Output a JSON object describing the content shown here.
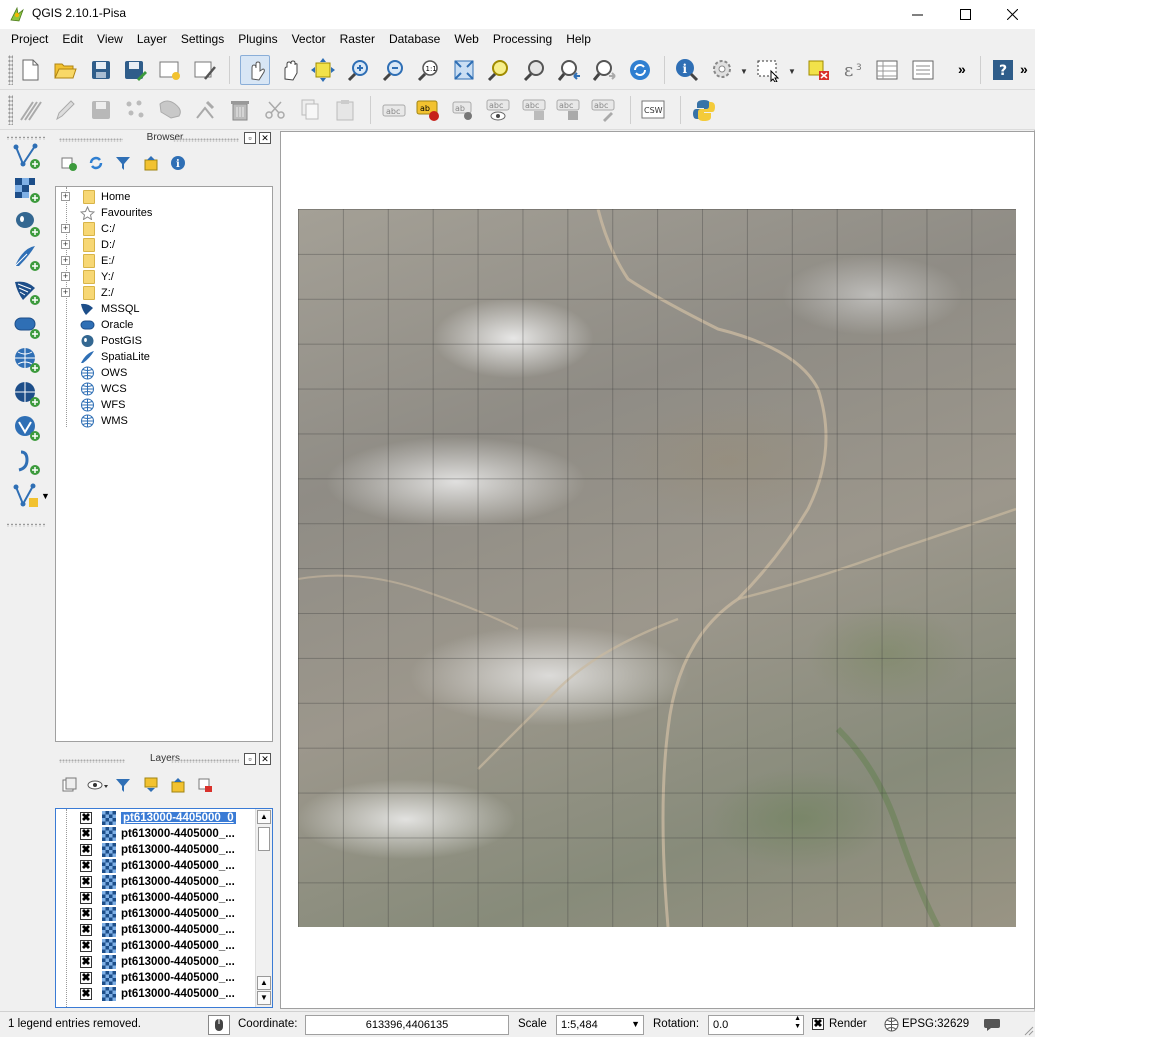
{
  "window": {
    "title": "QGIS 2.10.1-Pisa"
  },
  "menu": [
    "Project",
    "Edit",
    "View",
    "Layer",
    "Settings",
    "Plugins",
    "Vector",
    "Raster",
    "Database",
    "Web",
    "Processing",
    "Help"
  ],
  "toolbar1": {
    "icons": [
      "new-project-icon",
      "open-project-icon",
      "save-project-icon",
      "save-as-icon",
      "new-print-composer-icon",
      "composer-manager-icon",
      "touch-zoom-icon",
      "pan-icon",
      "pan-to-selection-icon",
      "zoom-in-icon",
      "zoom-out-icon",
      "zoom-actual-size-icon",
      "zoom-full-icon",
      "zoom-to-selection-icon",
      "zoom-to-layer-icon",
      "zoom-last-icon",
      "zoom-next-icon",
      "refresh-icon",
      "identify-icon",
      "run-feature-action-icon",
      "select-features-icon",
      "deselect-icon",
      "field-calculator-icon",
      "attribute-table-icon",
      "statistics-icon",
      "help-icon"
    ],
    "overflow": "»"
  },
  "toolbar2": {
    "icons": [
      "current-edits-icon",
      "toggle-editing-icon",
      "save-edits-icon",
      "add-feature-icon",
      "move-feature-icon",
      "node-tool-icon",
      "delete-selected-icon",
      "cut-features-icon",
      "copy-features-icon",
      "paste-features-icon",
      "label-abc-icon",
      "label-layer-icon",
      "pin-labels-icon",
      "show-hide-labels-icon",
      "move-label-icon",
      "rotate-label-icon",
      "change-label-icon",
      "csw-icon",
      "python-console-icon"
    ],
    "csw_label": "CSW",
    "abc_label": "abc",
    "ab_label": "ab"
  },
  "left_toolbar": [
    "add-vector-layer-icon",
    "add-raster-layer-icon",
    "add-postgis-layer-icon",
    "add-spatialite-layer-icon",
    "add-mssql-layer-icon",
    "add-oracle-layer-icon",
    "add-wms-layer-icon",
    "add-wcs-layer-icon",
    "add-wfs-layer-icon",
    "add-delimited-text-icon",
    "new-shapefile-layer-icon"
  ],
  "browser": {
    "title": "Browser",
    "tools": [
      "add-selected-icon",
      "refresh-icon",
      "filter-icon",
      "collapse-all-icon",
      "properties-icon"
    ],
    "items": [
      {
        "label": "Home",
        "icon": "folder",
        "expandable": true
      },
      {
        "label": "Favourites",
        "icon": "star",
        "expandable": false
      },
      {
        "label": "C:/",
        "icon": "folder",
        "expandable": true
      },
      {
        "label": "D:/",
        "icon": "folder",
        "expandable": true
      },
      {
        "label": "E:/",
        "icon": "folder",
        "expandable": true
      },
      {
        "label": "Y:/",
        "icon": "folder",
        "expandable": true
      },
      {
        "label": "Z:/",
        "icon": "folder",
        "expandable": true
      },
      {
        "label": "MSSQL",
        "icon": "mssql",
        "expandable": false
      },
      {
        "label": "Oracle",
        "icon": "oracle",
        "expandable": false
      },
      {
        "label": "PostGIS",
        "icon": "postgis",
        "expandable": false
      },
      {
        "label": "SpatiaLite",
        "icon": "spatialite",
        "expandable": false
      },
      {
        "label": "OWS",
        "icon": "globe",
        "expandable": false
      },
      {
        "label": "WCS",
        "icon": "globe",
        "expandable": false
      },
      {
        "label": "WFS",
        "icon": "globe",
        "expandable": false
      },
      {
        "label": "WMS",
        "icon": "globe",
        "expandable": false
      }
    ]
  },
  "layers": {
    "title": "Layers",
    "tools": [
      "add-group-icon",
      "manage-visibility-icon",
      "filter-legend-icon",
      "expand-all-icon",
      "collapse-all-icon",
      "remove-layer-icon"
    ],
    "items": [
      {
        "name": "pt613000-4405000_0",
        "checked": true,
        "selected": true
      },
      {
        "name": "pt613000-4405000_...",
        "checked": true,
        "selected": false
      },
      {
        "name": "pt613000-4405000_...",
        "checked": true,
        "selected": false
      },
      {
        "name": "pt613000-4405000_...",
        "checked": true,
        "selected": false
      },
      {
        "name": "pt613000-4405000_...",
        "checked": true,
        "selected": false
      },
      {
        "name": "pt613000-4405000_...",
        "checked": true,
        "selected": false
      },
      {
        "name": "pt613000-4405000_...",
        "checked": true,
        "selected": false
      },
      {
        "name": "pt613000-4405000_...",
        "checked": true,
        "selected": false
      },
      {
        "name": "pt613000-4405000_...",
        "checked": true,
        "selected": false
      },
      {
        "name": "pt613000-4405000_...",
        "checked": true,
        "selected": false
      },
      {
        "name": "pt613000-4405000_...",
        "checked": true,
        "selected": false
      },
      {
        "name": "pt613000-4405000_...",
        "checked": true,
        "selected": false
      }
    ]
  },
  "statusbar": {
    "message": "1 legend entries removed.",
    "coordinate_label": "Coordinate:",
    "coordinate_value": "613396,4406135",
    "scale_label": "Scale",
    "scale_value": "1:5,484",
    "rotation_label": "Rotation:",
    "rotation_value": "0.0",
    "render_label": "Render",
    "render_checked": true,
    "crs": "EPSG:32629"
  },
  "colors": {
    "accent": "#3a7bd5",
    "folder": "#f7d774",
    "toolbar_bg": "#f0f0f0"
  }
}
